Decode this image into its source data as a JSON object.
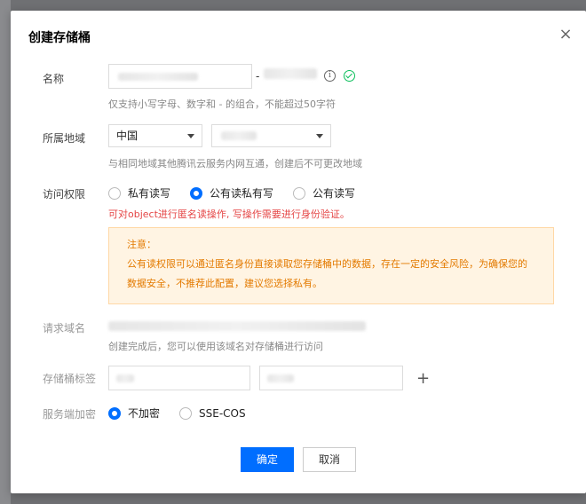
{
  "dialog": {
    "title": "创建存储桶",
    "close_symbol": "×"
  },
  "name_row": {
    "label": "名称",
    "separator": "-",
    "hint": "仅支持小写字母、数字和 - 的组合，不能超过50字符",
    "info_icon": "info-icon",
    "valid_icon": "check-circle-icon"
  },
  "region_row": {
    "label": "所属地域",
    "country": "中国",
    "hint": "与相同地域其他腾讯云服务内网互通，创建后不可更改地域"
  },
  "access_row": {
    "label": "访问权限",
    "options": [
      "私有读写",
      "公有读私有写",
      "公有读写"
    ],
    "selected_index": 1,
    "warning": "可对object进行匿名读操作, 写操作需要进行身份验证。",
    "notice_title": "注意：",
    "notice_body": "公有读权限可以通过匿名身份直接读取您存储桶中的数据，存在一定的安全风险，为确保您的数据安全，不推荐此配置，建议您选择私有。"
  },
  "domain_row": {
    "label": "请求域名",
    "hint": "创建完成后，您可以使用该域名对存储桶进行访问"
  },
  "tag_row": {
    "label": "存储桶标签",
    "add_symbol": "+"
  },
  "encrypt_row": {
    "label": "服务端加密",
    "options": [
      "不加密",
      "SSE-COS"
    ],
    "selected_index": 0
  },
  "footer": {
    "confirm_label": "确定",
    "cancel_label": "取消"
  },
  "colors": {
    "primary": "#006eff",
    "warning_text": "#e54545",
    "notice_text": "#e37a00",
    "notice_bg": "#fff4e3",
    "valid": "#0abf5b"
  }
}
